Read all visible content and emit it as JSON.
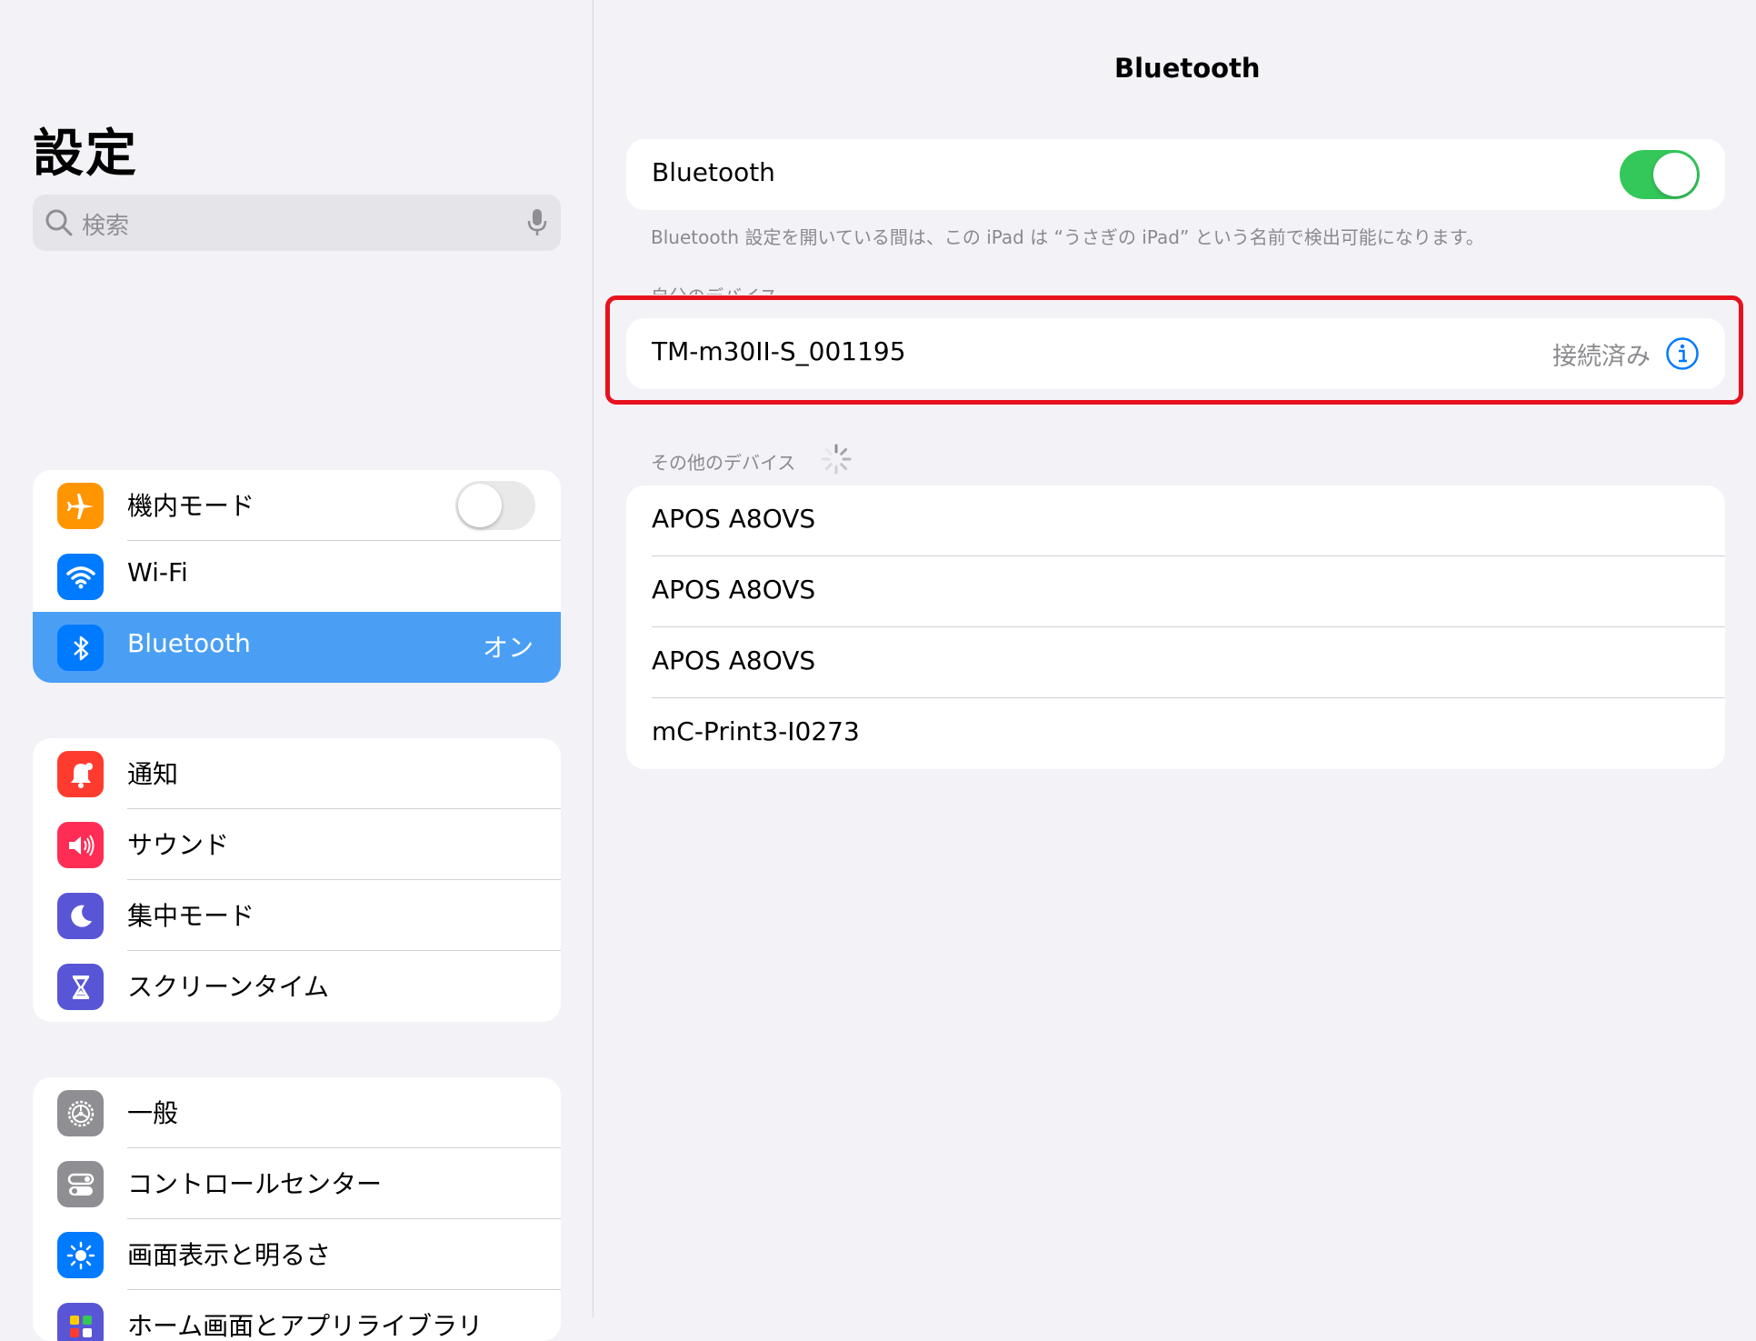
{
  "sidebar": {
    "title": "設定",
    "search_placeholder": "検索",
    "group1": [
      {
        "label": "機内モード",
        "icon": "airplane-icon",
        "color": "#ff9500"
      },
      {
        "label": "Wi-Fi",
        "icon": "wifi-icon",
        "color": "#007aff"
      },
      {
        "label": "Bluetooth",
        "icon": "bluetooth-icon",
        "color": "#007aff",
        "value": "オン",
        "selected": true
      }
    ],
    "group2": [
      {
        "label": "通知",
        "icon": "bell-icon",
        "color": "#ff3b30"
      },
      {
        "label": "サウンド",
        "icon": "speaker-icon",
        "color": "#ff2d55"
      },
      {
        "label": "集中モード",
        "icon": "moon-icon",
        "color": "#5856d6"
      },
      {
        "label": "スクリーンタイム",
        "icon": "hourglass-icon",
        "color": "#5856d6"
      }
    ],
    "group3": [
      {
        "label": "一般",
        "icon": "gear-icon",
        "color": "#8e8e93"
      },
      {
        "label": "コントロールセンター",
        "icon": "toggles-icon",
        "color": "#8e8e93"
      },
      {
        "label": "画面表示と明るさ",
        "icon": "sun-icon",
        "color": "#007aff"
      },
      {
        "label": "ホーム画面とアプリライブラリ",
        "icon": "apps-grid-icon",
        "color": "#5856d6"
      }
    ]
  },
  "main": {
    "title": "Bluetooth",
    "bluetooth_label": "Bluetooth",
    "bluetooth_on": true,
    "footnote": "Bluetooth 設定を開いている間は、この iPad は “うさぎの iPad” という名前で検出可能になります。",
    "my_devices_header": "自分のデバイス",
    "my_devices": [
      {
        "name": "TM-m30II-S_001195",
        "status": "接続済み"
      }
    ],
    "other_devices_header": "その他のデバイス",
    "other_devices": [
      {
        "name": "APOS A8OVS"
      },
      {
        "name": "APOS A8OVS"
      },
      {
        "name": "APOS A8OVS"
      },
      {
        "name": "mC-Print3-I0273"
      }
    ]
  },
  "colors": {
    "accent": "#007aff",
    "selected_row": "#4a9ff5",
    "toggle_on": "#34c759",
    "highlight_border": "#e8121e"
  }
}
